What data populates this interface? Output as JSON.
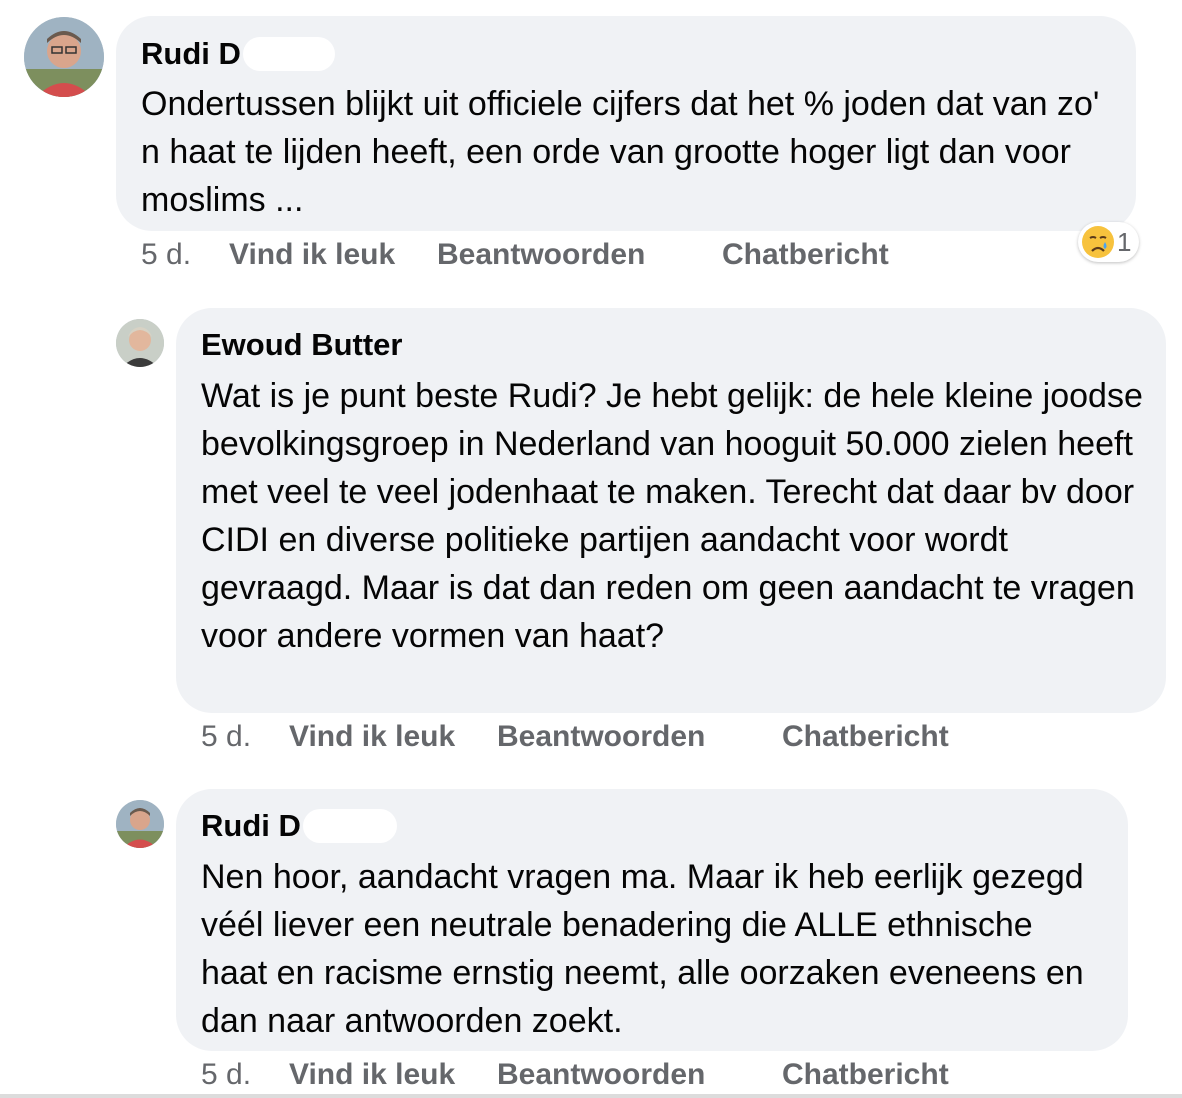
{
  "comments": [
    {
      "author": "Rudi D",
      "text": "Ondertussen blijkt uit officiele cijfers dat het % joden dat van zo' n haat te lijden heeft, een orde van grootte hoger ligt dan voor moslims ...",
      "time": "5 d.",
      "like_label": "Vind ik leuk",
      "reply_label": "Beantwoorden",
      "chat_label": "Chatbericht",
      "reaction_icon": "sad-cry-emoji",
      "reaction_count": "1"
    },
    {
      "author": "Ewoud Butter",
      "text": "Wat is je punt beste Rudi? Je hebt gelijk: de hele kleine joodse bevolkingsgroep in Nederland van hooguit 50.000 zielen heeft met veel te veel jodenhaat te maken. Terecht dat daar bv door CIDI en diverse politieke partijen aandacht voor wordt gevraagd. Maar is dat dan reden om geen aandacht te vragen voor andere vormen van haat?",
      "time": "5 d.",
      "like_label": "Vind ik leuk",
      "reply_label": "Beantwoorden",
      "chat_label": "Chatbericht"
    },
    {
      "author": "Rudi D",
      "text": "Nen hoor, aandacht vragen ma. Maar ik heb eerlijk gezegd véél liever een neutrale benadering die ALLE ethnische haat en racisme ernstig neemt, alle oorzaken eveneens en dan naar antwoorden zoekt.",
      "time": "5 d.",
      "like_label": "Vind ik leuk",
      "reply_label": "Beantwoorden",
      "chat_label": "Chatbericht"
    }
  ]
}
